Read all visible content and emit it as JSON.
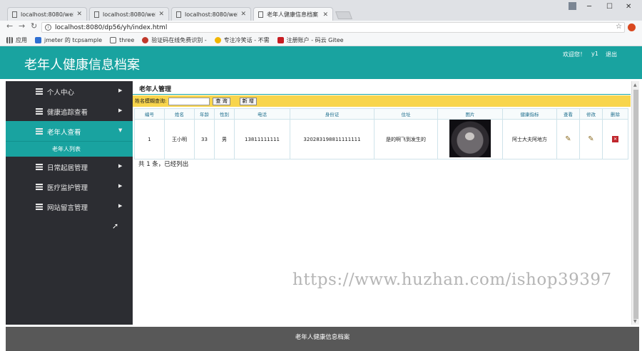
{
  "browser": {
    "tabs": [
      {
        "title": "localhost:8080/webtoo",
        "active": false
      },
      {
        "title": "localhost:8080/webtoo",
        "active": false
      },
      {
        "title": "localhost:8080/webtoo",
        "active": false
      },
      {
        "title": "老年人健康信息档案",
        "active": true
      }
    ],
    "url": "localhost:8080/dp56/yh/index.html",
    "bookmarks": [
      {
        "label": "应用",
        "icon": "apps-icon"
      },
      {
        "label": "jmeter 的 tcpsample",
        "icon": "shield-icon"
      },
      {
        "label": "three",
        "icon": "page-icon"
      },
      {
        "label": "验证码在线免费识别 -",
        "icon": "site-icon"
      },
      {
        "label": "专注冷笑话 - 不需",
        "icon": "emoji-icon"
      },
      {
        "label": "注册账户 - 码云 Gitee",
        "icon": "gitee-icon"
      }
    ],
    "window_controls": {
      "minimize": "─",
      "maximize": "☐",
      "close": "✕"
    }
  },
  "app": {
    "title": "老年人健康信息档案",
    "welcome": "欢迎您！",
    "username": "y1",
    "logout": "退出",
    "sidebar": {
      "items": [
        {
          "label": "个人中心",
          "active": false
        },
        {
          "label": "健康追踪查看",
          "active": false
        },
        {
          "label": "老年人查看",
          "active": true
        },
        {
          "label": "日常起居管理",
          "active": false
        },
        {
          "label": "医疗监护管理",
          "active": false
        },
        {
          "label": "网站留言管理",
          "active": false
        }
      ],
      "active_sub": "老年人列表"
    },
    "content": {
      "breadcrumb": "老年人管理",
      "search_label": "姓名模糊查询:",
      "search_value": "",
      "query_button": "查 询",
      "add_button": "新 增",
      "table": {
        "headers": [
          "编号",
          "姓名",
          "年龄",
          "性别",
          "电话",
          "身份证",
          "住址",
          "图片",
          "健康指标",
          "查看",
          "修改",
          "删除"
        ],
        "rows": [
          {
            "id": "1",
            "name": "王小明",
            "age": "33",
            "gender": "男",
            "phone": "13811111111",
            "idcard": "320283198811111111",
            "address": "是的啊飞到发生的",
            "health": "阿士大夫阿地方"
          }
        ]
      },
      "total_text": "共 1 条，已经列出"
    },
    "footer": "老年人健康信息档案"
  },
  "overlay": {
    "watermark": "https://www.huzhan.com/ishop39397"
  },
  "colors": {
    "header_teal": "#19a3a0",
    "sidebar_dark": "#2c2d32",
    "search_yellow": "#f8d54c",
    "footer_gray": "#585858"
  }
}
